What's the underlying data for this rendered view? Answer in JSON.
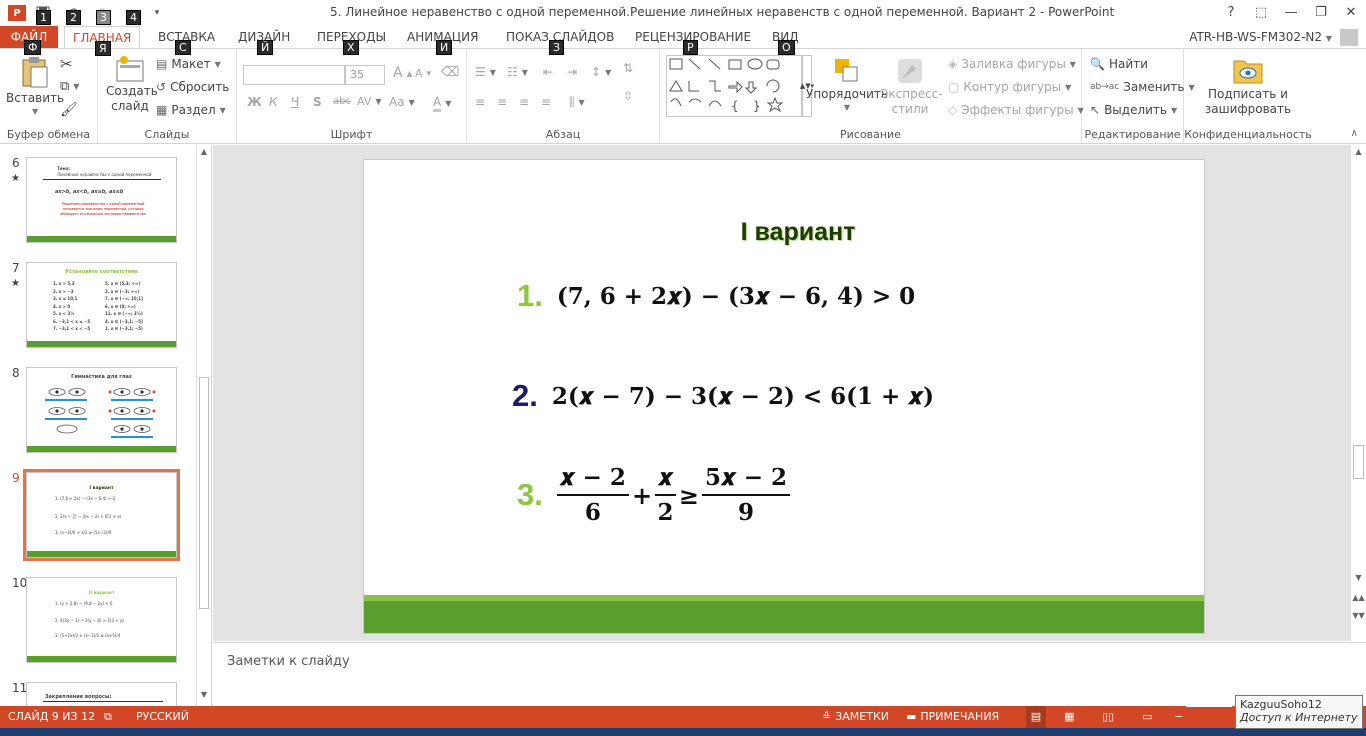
{
  "window": {
    "title": "5. Линейное неравенство с одной переменной.Решение линейных неравенств с одной переменной. Вариант 2 - PowerPoint",
    "help": "?",
    "minimize": "—",
    "restore": "❐",
    "close": "✕"
  },
  "qat": {
    "keytips": [
      "1",
      "2",
      "3",
      "4"
    ]
  },
  "tabs": [
    {
      "label": "ФАЙЛ",
      "keytip": "Ф"
    },
    {
      "label": "ГЛАВНАЯ",
      "keytip": "Я"
    },
    {
      "label": "ВСТАВКА",
      "keytip": "С"
    },
    {
      "label": "ДИЗАЙН",
      "keytip": "Й"
    },
    {
      "label": "ПЕРЕХОДЫ",
      "keytip": "Х"
    },
    {
      "label": "АНИМАЦИЯ",
      "keytip": "И"
    },
    {
      "label": "ПОКАЗ СЛАЙДОВ",
      "keytip": "З"
    },
    {
      "label": "РЕЦЕНЗИРОВАНИЕ",
      "keytip": "Р"
    },
    {
      "label": "ВИД",
      "keytip": "О"
    }
  ],
  "account": "ATR-HB-WS-FM302-N2",
  "ribbon": {
    "clipboard": {
      "label": "Буфер обмена",
      "paste": "Вставить"
    },
    "slides": {
      "label": "Слайды",
      "new_slide": "Создать слайд",
      "layout": "Макет",
      "reset": "Сбросить",
      "section": "Раздел"
    },
    "font": {
      "label": "Шрифт",
      "size": "35",
      "bold": "Ж",
      "italic": "К",
      "underline": "Ч",
      "shadow": "S",
      "strike": "abc",
      "spacing": "AV",
      "case": "Aa",
      "color": "A",
      "grow": "A",
      "shrink": "A"
    },
    "paragraph": {
      "label": "Абзац"
    },
    "drawing": {
      "label": "Рисование",
      "arrange": "Упорядочить",
      "quick_styles": "Экспресс-стили",
      "fill": "Заливка фигуры",
      "outline": "Контур фигуры",
      "effects": "Эффекты фигуры"
    },
    "editing": {
      "label": "Редактирование",
      "find": "Найти",
      "replace": "Заменить",
      "select": "Выделить"
    },
    "privacy": {
      "label": "Конфиденциальность",
      "sign": "Подписать и зашифровать"
    }
  },
  "thumbnails": [
    {
      "number": "6",
      "star": "★",
      "title": "Тема:",
      "subtitle": "Линейные неравенства с одной переменной",
      "row": "ax>b,  ax<b,  ax≥b,  ax≤b",
      "body": "Решением неравенства с одной переменной называется значение переменной, которое обращает его в верное числовое неравенство"
    },
    {
      "number": "7",
      "star": "★",
      "title": "Установите соответствие",
      "left": [
        "1. x > 5,3",
        "2. x > −3",
        "3. x ≤ 10,1",
        "4. x > 0",
        "5. x < 3½",
        "6. −3,1 < x ≤ −5",
        "7. −3,1 < x < −5"
      ],
      "right": [
        "5. x ∈ (5,3; +∞)",
        "2. x ∈ (−3; +∞)",
        "7. x ∈ (−∞; 10,1]",
        "6. x ∈ (0; +∞)",
        "11. x ∈ (−∞; 3½)",
        "4. x ∈ (−3,1; −5]",
        "1. x ∈ (−3,1; −5)"
      ]
    },
    {
      "number": "8",
      "title": "Гимнастика для глаз"
    },
    {
      "number": "9",
      "title": "I вариант",
      "lines": [
        "1.  (7,6 + 2x) − (3x − 6,4) > 0",
        "2.  2(x − 7) − 3(x − 2) < 6(1 + x)",
        "3.  (x−2)/6 + x/2 ≥ (5x−2)/9"
      ]
    },
    {
      "number": "10",
      "title": "II вариант",
      "lines": [
        "1.  (y + 2,8) − (9,8 − 2y) < 0",
        "2.  4(3y − 1) − 3(y − 8) > 2(3 + y)",
        "3.  (5+2x)/3 + (x−3)/2 ≤ (x+5)/4"
      ]
    },
    {
      "number": "11",
      "title": "Закрепление вопросы:"
    }
  ],
  "slide": {
    "title": "I вариант",
    "problems": [
      {
        "num": "1.",
        "color": "#8dc63f",
        "expr": "(𝟕, 𝟔 + 𝟐𝒙) − (𝟑𝒙 − 𝟔, 𝟒) > 𝟎"
      },
      {
        "num": "2.",
        "color": "#1a1a6e",
        "expr": "𝟐(𝒙 − 𝟕) − 𝟑(𝒙 − 𝟐) < 𝟔(𝟏 + 𝒙)"
      },
      {
        "num": "3.",
        "color": "#8dc63f",
        "f1n": "𝒙 − 𝟐",
        "f1d": "𝟔",
        "op1": "+",
        "f2n": "𝒙",
        "f2d": "𝟐",
        "op2": "≥",
        "f3n": "𝟓𝒙 − 𝟐",
        "f3d": "𝟗"
      }
    ]
  },
  "notes_placeholder": "Заметки к слайду",
  "status": {
    "slide": "СЛАЙД 9 ИЗ 12",
    "language": "РУССКИЙ",
    "notes": "ЗАМЕТКИ",
    "comments": "ПРИМЕЧАНИЯ"
  },
  "tooltip": {
    "name": "KazguuSoho12",
    "status": "Доступ к Интернету"
  },
  "colors": {
    "accent": "#d24726",
    "slide_green": "#5a9e2f",
    "selection": "#e5744c"
  }
}
